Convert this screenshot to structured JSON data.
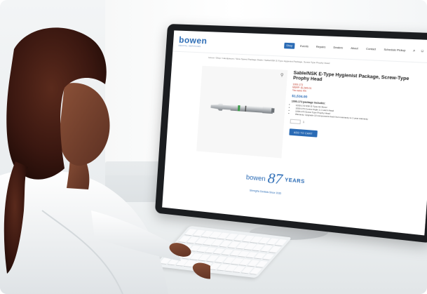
{
  "site": {
    "logo": "bowen",
    "logo_sub": "DENTAL SERVICES",
    "nav": [
      "Shop",
      "Events",
      "Repairs",
      "Dealers",
      "About",
      "Contact",
      "Schedule Pickup"
    ],
    "breadcrumb": "Home / Shop / Handpieces / Slow Speed Package Deals / Sable/NSK E-Type Hygienist Package, Screw-Type Prophy Head"
  },
  "product": {
    "title": "Sable/NSK E-Type Hygienist Package, Screw-Type Prophy Head",
    "sku": "1000-173",
    "msrp": "MSRP: $1,545.01",
    "save": "You save 4%",
    "price": "$1,534.00",
    "includes_label": "1000-173 package includes:",
    "includes": [
      "1000-173 NSK E-Type Air Motor",
      "1000-173 Contra Angle 1:1 Latch Head",
      "1000-173 Screw Type Prophy Head",
      "Warranty: Upgrade 10 components back from warranty to 1 year warranty"
    ],
    "qty_value": "1",
    "cart_button": "ADD TO CART"
  },
  "footer": {
    "brand": "bowen",
    "anniversary": "87",
    "years": "YEARS",
    "tagline": "Strengths Dentists Since 1935"
  },
  "colors": {
    "brand_blue": "#2a6bb5",
    "sale_red": "#c0392b"
  }
}
